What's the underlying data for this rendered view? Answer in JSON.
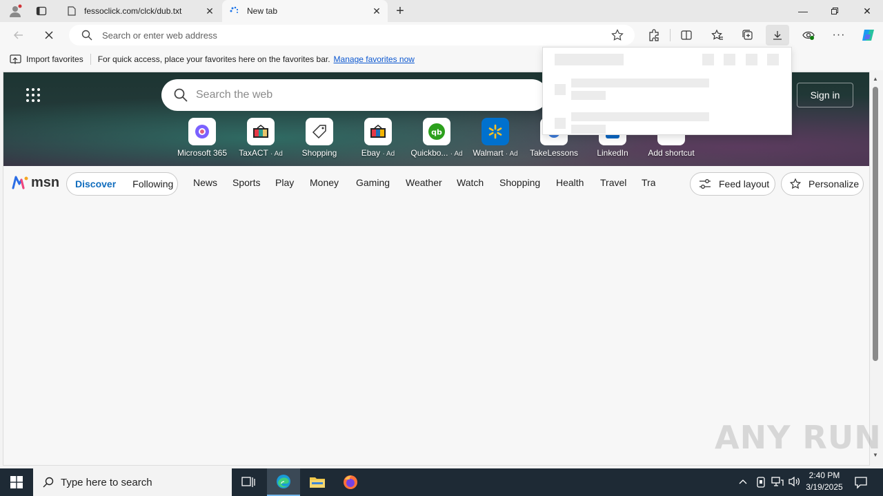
{
  "tabs": [
    {
      "title": "fessoclick.com/clck/dub.txt",
      "active": false
    },
    {
      "title": "New tab",
      "active": true
    }
  ],
  "address": {
    "placeholder": "Search or enter web address"
  },
  "favbar": {
    "import_label": "Import favorites",
    "message": "For quick access, place your favorites here on the favorites bar.",
    "manage_link": "Manage favorites now"
  },
  "newtab": {
    "search_placeholder": "Search the web",
    "signin_label": "Sign in",
    "shortcuts": [
      {
        "label": "Microsoft 365",
        "ad": ""
      },
      {
        "label": "TaxACT",
        "ad": "· Ad"
      },
      {
        "label": "Shopping",
        "ad": ""
      },
      {
        "label": "Ebay",
        "ad": "· Ad"
      },
      {
        "label": "Quickbo...",
        "ad": "· Ad"
      },
      {
        "label": "Walmart",
        "ad": "· Ad"
      },
      {
        "label": "TakeLessons",
        "ad": ""
      },
      {
        "label": "LinkedIn",
        "ad": ""
      },
      {
        "label": "Add shortcut",
        "ad": ""
      }
    ]
  },
  "msn": {
    "logo": "msn",
    "discover": "Discover",
    "following": "Following",
    "nav": [
      "News",
      "Sports",
      "Play",
      "Money",
      "Gaming",
      "Weather",
      "Watch",
      "Shopping",
      "Health",
      "Travel",
      "Trai"
    ],
    "feed_layout": "Feed layout",
    "personalize": "Personalize"
  },
  "taskbar": {
    "search_placeholder": "Type here to search",
    "time": "2:40 PM",
    "date": "3/19/2025"
  },
  "watermark": "ANY RUN"
}
